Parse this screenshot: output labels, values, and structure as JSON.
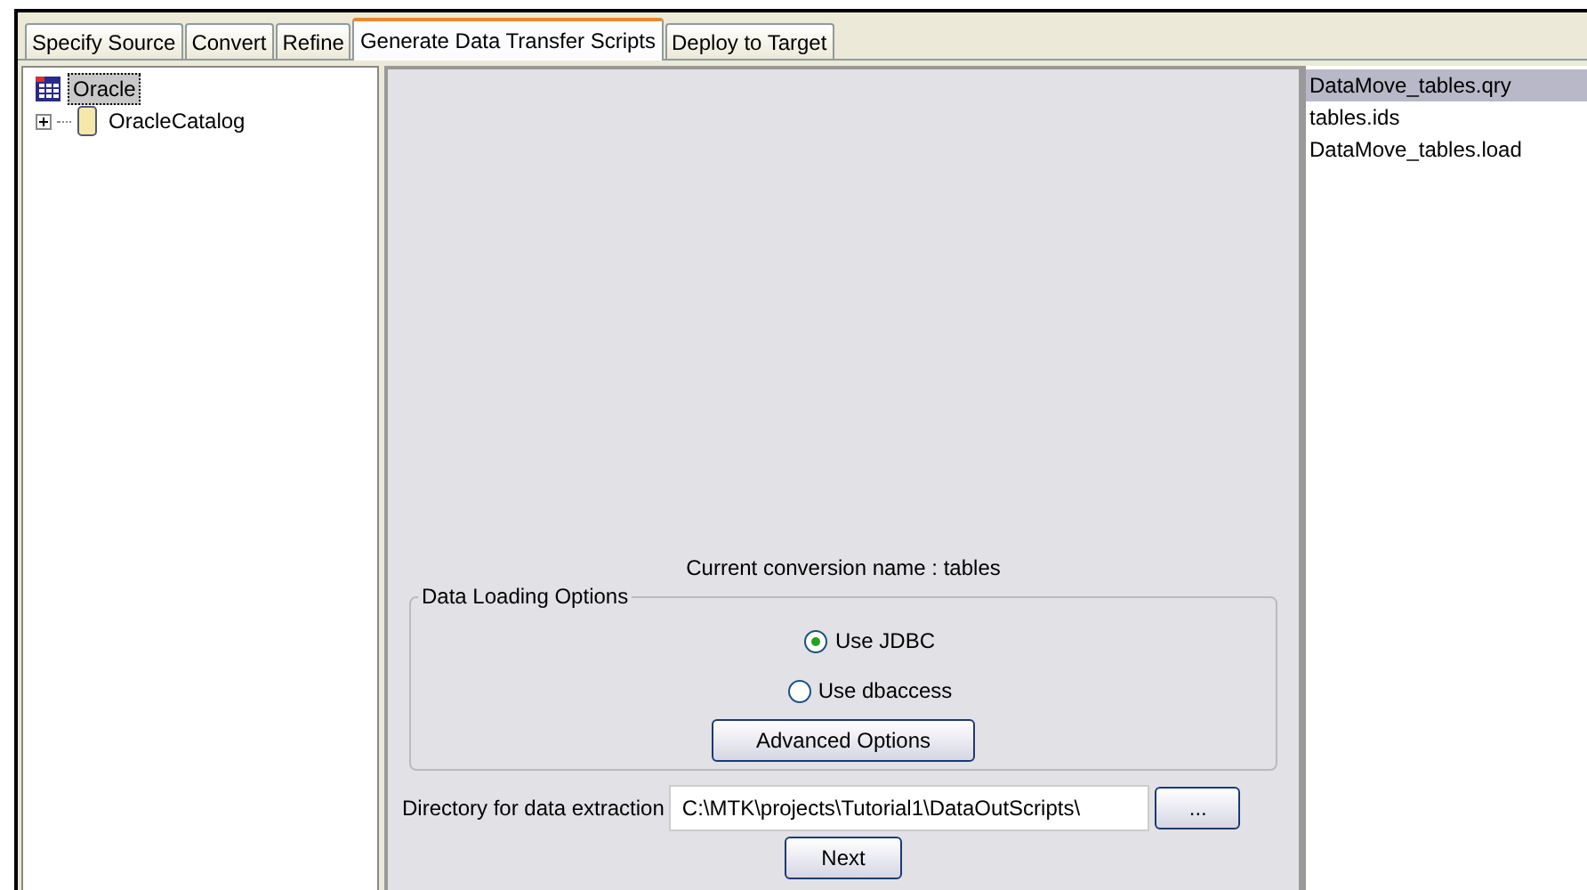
{
  "tabs": [
    {
      "label": "Specify Source",
      "selected": false
    },
    {
      "label": "Convert",
      "selected": false
    },
    {
      "label": "Refine",
      "selected": false
    },
    {
      "label": "Generate Data Transfer Scripts",
      "selected": true
    },
    {
      "label": "Deploy to Target",
      "selected": false
    }
  ],
  "tree": [
    {
      "label": "Oracle",
      "selected": true,
      "kind": "schema",
      "children": [
        {
          "label": "OracleCatalog",
          "selected": false,
          "kind": "catalog",
          "expanded": false
        }
      ]
    }
  ],
  "conversion_name": "Current conversion name : tables",
  "data_loading_options": {
    "title": "Data Loading Options",
    "options": [
      {
        "label": "Use JDBC",
        "selected": true
      },
      {
        "label": "Use dbaccess",
        "selected": false
      }
    ],
    "advanced_button": "Advanced Options"
  },
  "directory": {
    "label": "Directory for data extraction",
    "value": "C:\\MTK\\projects\\Tutorial1\\DataOutScripts\\",
    "browse_button": "..."
  },
  "next_button": "Next",
  "files": [
    {
      "label": "DataMove_tables.qry",
      "selected": true
    },
    {
      "label": "tables.ids",
      "selected": false
    },
    {
      "label": "DataMove_tables.load",
      "selected": false
    }
  ]
}
